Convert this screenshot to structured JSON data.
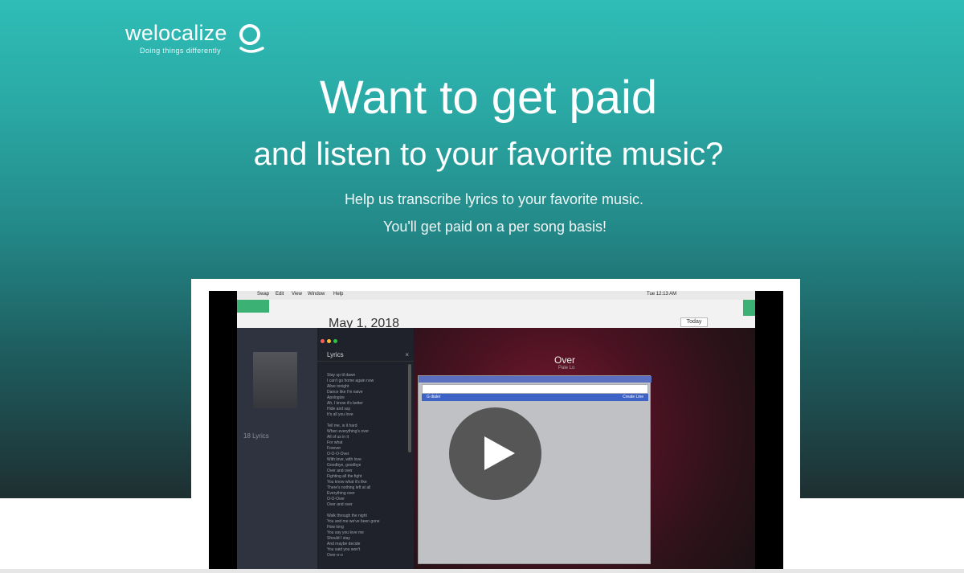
{
  "logo": {
    "word": "welocalize",
    "tagline": "Doing things differently"
  },
  "hero": {
    "headline": "Want to get paid",
    "subheadline": "and listen to your favorite music?",
    "line1": "Help us transcribe lyrics to your favorite music.",
    "line2": "You'll get paid on a per song basis!"
  },
  "video": {
    "menubar": {
      "app": "Swap",
      "items": [
        "Edit",
        "View",
        "Window",
        "Help"
      ],
      "clock": "Tue 12:13 AM"
    },
    "calendar": {
      "date": "May 1, 2018",
      "today_label": "Today"
    },
    "sidebar": {
      "label": "18 Lyrics"
    },
    "lyrics": {
      "header": "Lyrics",
      "text": "Stay up til dawn\nI can't go home again now\nAlive tonight\nDance like I'm naive\nApologize\nAh, I know it's better\nHide and say\nIt's all you love\n\nTell me, is it hard\nWhen everything's over\nAll of us in it\nFor what\nForever\nO-O-O-Over\nWith love, with love\nGoodbye, goodbye\nOver and over\nFighting all the fight\nYou know what it's like\nThere's nothing left at all\nEverything over\nO-O-Over\nOver and over\n\nWalk through the night\nYou and me we've been gone\nHow long\nYou say you love me\nShould I stay\nAnd maybe decide\nYou said you won't\nOver-o-o"
    },
    "player": {
      "song_title": "Over",
      "artist": "Pale Lo"
    },
    "dialog": {
      "row_left": "G dialer",
      "row_right": "Create Line"
    }
  },
  "colors": {
    "gradient_top": "#2fbdb7",
    "gradient_bottom": "#1e2f31",
    "play_button": "#505050"
  }
}
